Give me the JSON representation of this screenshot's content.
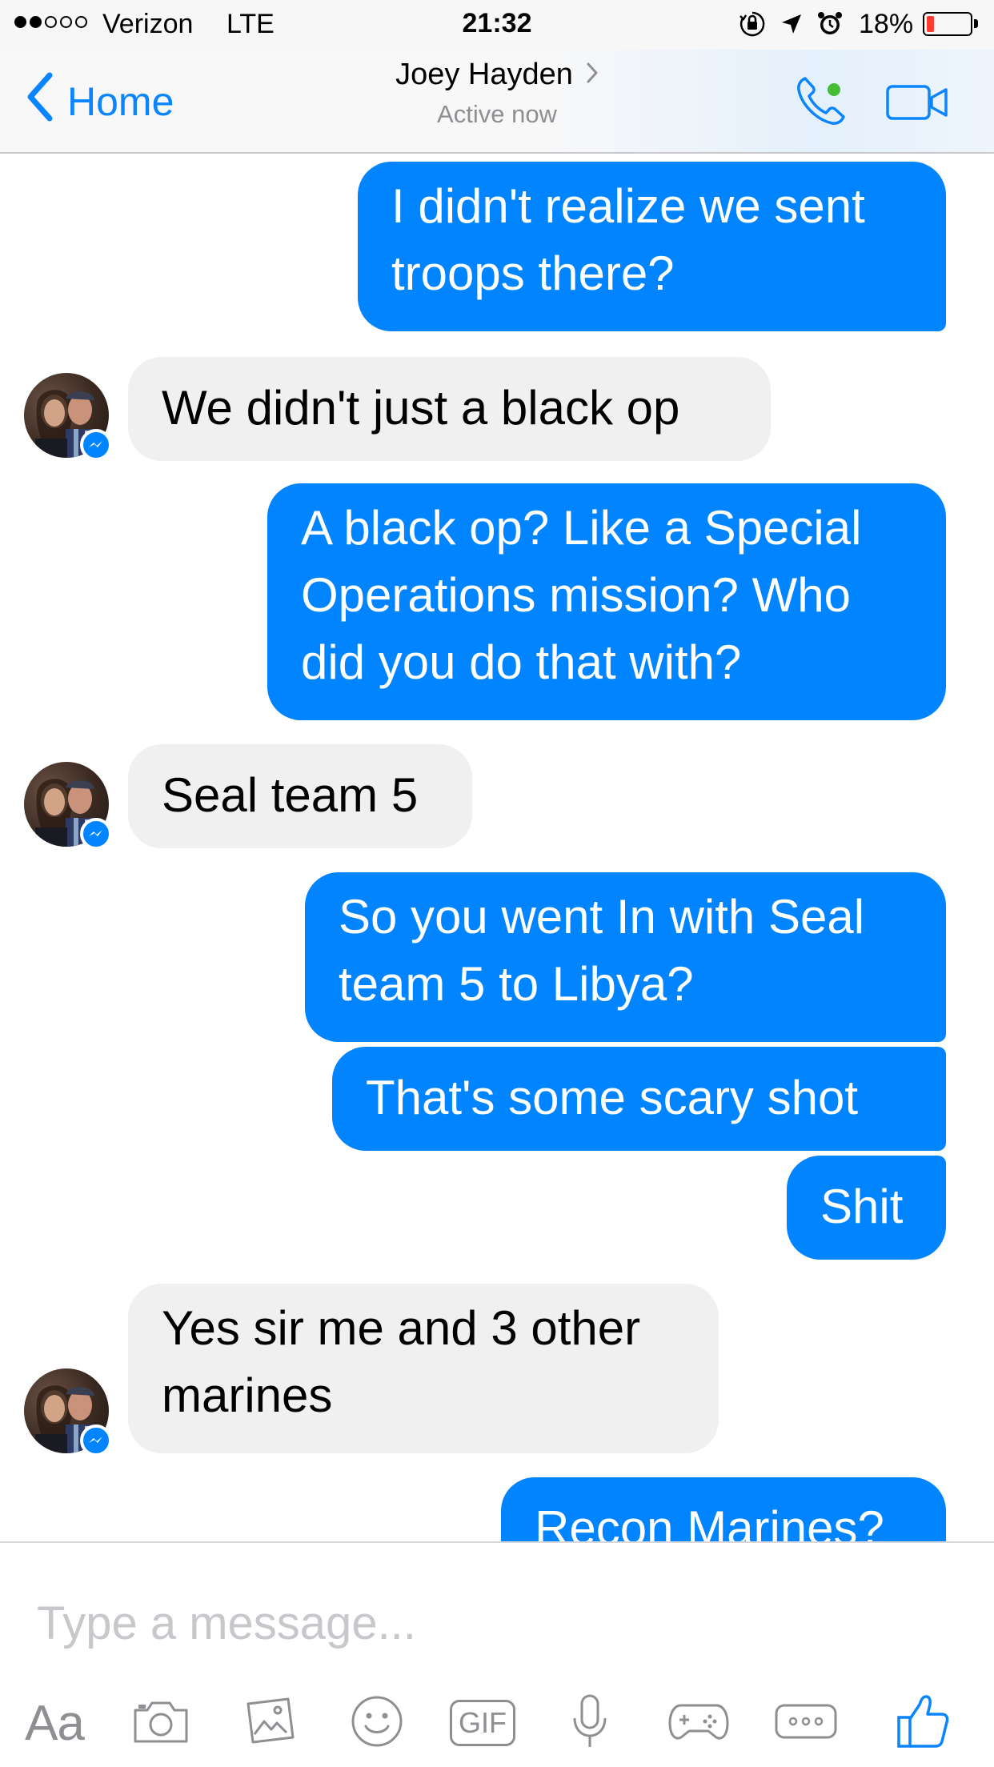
{
  "status_bar": {
    "signal_dots": [
      "on",
      "on",
      "off",
      "off",
      "off"
    ],
    "carrier": "Verizon",
    "network": "LTE",
    "time": "21:32",
    "icons": [
      "orientation-lock-icon",
      "location-arrow-icon",
      "alarm-clock-icon"
    ],
    "battery_percent": "18%",
    "battery_level": 0.18
  },
  "nav": {
    "back_label": "Home",
    "contact_name": "Joey Hayden",
    "contact_status": "Active now",
    "call_icon": "phone-icon",
    "video_icon": "video-camera-icon",
    "active_dot_color": "#44bd32"
  },
  "thread": {
    "messages": [
      {
        "direction": "out",
        "lines": [
          "I didn't realize we sent",
          "troops there?"
        ]
      },
      {
        "direction": "in",
        "lines": [
          "We didn't just a black op"
        ],
        "avatar": true
      },
      {
        "direction": "out",
        "lines": [
          "A black op? Like a Special",
          "Operations mission? Who",
          "did you do that with?"
        ]
      },
      {
        "direction": "in",
        "lines": [
          "Seal team 5"
        ],
        "avatar": true
      },
      {
        "direction": "out",
        "lines": [
          "So you went In with Seal",
          "team 5 to Libya?"
        ]
      },
      {
        "direction": "out",
        "lines": [
          "That's some scary shot"
        ]
      },
      {
        "direction": "out",
        "lines": [
          "Shit"
        ]
      },
      {
        "direction": "in",
        "lines": [
          "Yes sir me and 3 other",
          "marines"
        ],
        "avatar": true
      },
      {
        "direction": "out",
        "lines": [
          "Recon Marines?"
        ]
      }
    ]
  },
  "composer": {
    "placeholder": "Type a message...",
    "value": "",
    "tools": [
      {
        "name": "text-style-icon",
        "label": "Aa"
      },
      {
        "name": "camera-icon"
      },
      {
        "name": "gallery-icon"
      },
      {
        "name": "emoji-icon"
      },
      {
        "name": "gif-icon",
        "label": "GIF"
      },
      {
        "name": "microphone-icon"
      },
      {
        "name": "games-icon"
      },
      {
        "name": "more-icon"
      },
      {
        "name": "thumbs-up-icon"
      }
    ]
  },
  "colors": {
    "accent": "#0a84ff",
    "outgoing_bubble": "#0084ff",
    "incoming_bubble": "#f1f0f0",
    "battery_low": "#ff3b30"
  }
}
